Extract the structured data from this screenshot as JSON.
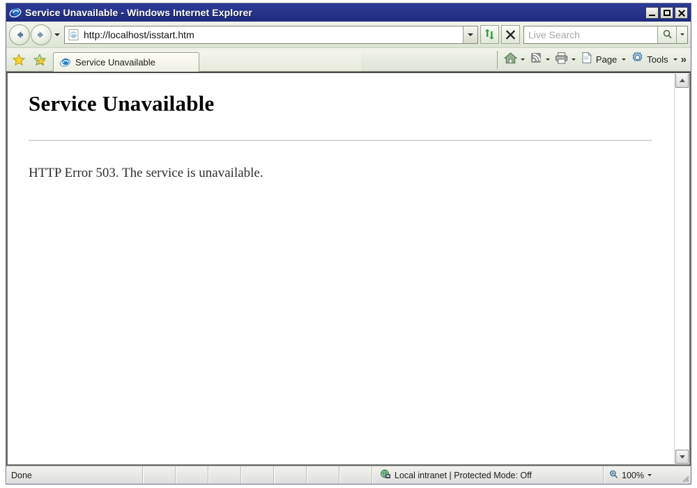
{
  "window": {
    "title": "Service Unavailable - Windows Internet Explorer",
    "icon": "ie-logo-icon",
    "controls": {
      "minimize": "Minimize",
      "maximize": "Maximize",
      "close": "Close"
    }
  },
  "navbar": {
    "back": "Back",
    "forward": "Forward",
    "recent_pages": "Recent Pages",
    "address": {
      "value": "http://localhost/isstart.htm",
      "icon": "page-icon"
    },
    "refresh": "Refresh",
    "stop": "Stop",
    "search": {
      "placeholder": "Live Search",
      "value": "",
      "go": "Search",
      "providers": "Search Options"
    }
  },
  "tabbar": {
    "favorites_center": "Favorites Center",
    "add_to_favorites": "Add to Favorites",
    "tabs": [
      {
        "label": "Service Unavailable",
        "icon": "ie-logo-icon",
        "active": true
      }
    ]
  },
  "commandbar": {
    "items": [
      {
        "label": "",
        "icon": "home-icon",
        "has_arrow": true
      },
      {
        "label": "",
        "icon": "rss-feed-icon",
        "has_arrow": true
      },
      {
        "label": "",
        "icon": "print-icon",
        "has_arrow": true
      },
      {
        "label": "Page",
        "icon": "page-document-icon",
        "has_arrow": true
      },
      {
        "label": "Tools",
        "icon": "tools-gear-icon",
        "has_arrow": true
      }
    ],
    "overflow": "»"
  },
  "page": {
    "heading": "Service Unavailable",
    "body": "HTTP Error 503. The service is unavailable."
  },
  "scrollbar": {
    "up": "Scroll up",
    "down": "Scroll down"
  },
  "statusbar": {
    "status": "Done",
    "zone": "Local intranet | Protected Mode: Off",
    "zone_icon": "security-zone-icon",
    "zoom": {
      "icon": "zoom-in-icon",
      "level": "100%"
    },
    "resize_grip": "Resize"
  },
  "colors": {
    "titlebar": "#27358c",
    "toolbar": "#e7ece0",
    "page_background": "#ffffff",
    "status_background": "#e4e4e0"
  }
}
